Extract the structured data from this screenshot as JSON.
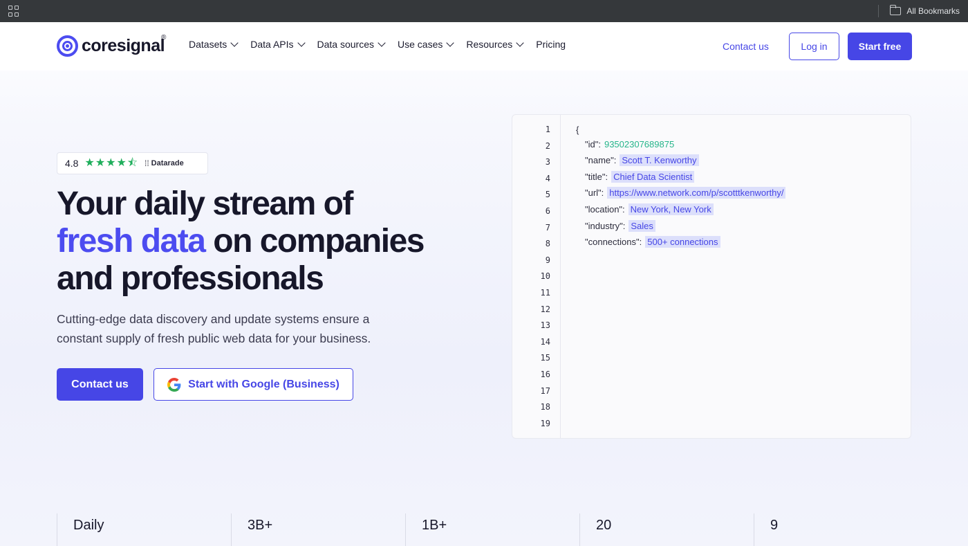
{
  "browser": {
    "bookmarks_label": "All Bookmarks"
  },
  "nav": {
    "brand": "coresignal",
    "brand_mark": "®",
    "menu": [
      {
        "label": "Datasets",
        "dropdown": true
      },
      {
        "label": "Data APIs",
        "dropdown": true
      },
      {
        "label": "Data sources",
        "dropdown": true
      },
      {
        "label": "Use cases",
        "dropdown": true
      },
      {
        "label": "Resources",
        "dropdown": true
      },
      {
        "label": "Pricing",
        "dropdown": false
      }
    ],
    "contact_label": "Contact us",
    "login_label": "Log in",
    "start_label": "Start free"
  },
  "rating": {
    "score": "4.8",
    "stars": 4.5,
    "source": "Datarade"
  },
  "hero": {
    "title_part1": "Your daily stream of",
    "title_accent": "fresh data",
    "title_part2": " on companies and professionals",
    "subtitle": "Cutting-edge data discovery and update systems ensure a constant supply of fresh public web data for your business.",
    "contact_button": "Contact us",
    "google_button": "Start with Google (Business)"
  },
  "code_sample": {
    "open_brace": "{",
    "line_numbers": [
      "1",
      "2",
      "3",
      "4",
      "5",
      "6",
      "7",
      "8",
      "9",
      "10",
      "11",
      "12",
      "13",
      "14",
      "15",
      "16",
      "17",
      "18",
      "19"
    ],
    "fields": [
      {
        "key": "\"id\":",
        "value": "93502307689875",
        "type": "number"
      },
      {
        "key": "\"name\":",
        "value": "Scott T. Kenworthy",
        "type": "string"
      },
      {
        "key": "\"title\":",
        "value": "Chief Data Scientist",
        "type": "string"
      },
      {
        "key": "\"url\":",
        "value": "https://www.network.com/p/scotttkenworthy/",
        "type": "string"
      },
      {
        "key": "\"location\":",
        "value": "New York, New York",
        "type": "string"
      },
      {
        "key": "\"industry\":",
        "value": "Sales",
        "type": "string"
      },
      {
        "key": "\"connections\":",
        "value": "500+ connections",
        "type": "string"
      }
    ]
  },
  "stats": [
    {
      "value": "Daily"
    },
    {
      "value": "3B+"
    },
    {
      "value": "1B+"
    },
    {
      "value": "20"
    },
    {
      "value": "9"
    }
  ],
  "colors": {
    "accent": "#4646e6",
    "star": "#1fae5b",
    "number_value": "#26b58a",
    "highlight_bg": "#dcdffb"
  }
}
